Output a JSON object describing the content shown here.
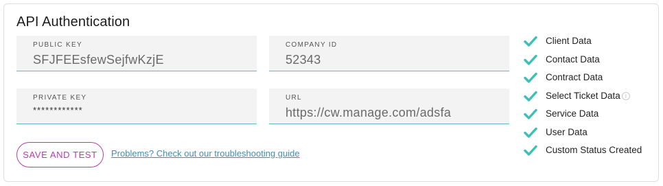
{
  "card": {
    "title": "API Authentication"
  },
  "fields": {
    "public_key": {
      "label": "PUBLIC KEY",
      "value": "SFJFEEsfewSejfwKzjE"
    },
    "company_id": {
      "label": "COMPANY ID",
      "value": "52343"
    },
    "private_key": {
      "label": "PRIVATE KEY",
      "value": "************"
    },
    "url": {
      "label": "URL",
      "value": "https://cw.manage.com/adsfa"
    }
  },
  "actions": {
    "save_label": "SAVE AND TEST",
    "help_link": "Problems?  Check out our troubleshooting guide"
  },
  "checklist": [
    {
      "label": "Client Data",
      "icon": "check-icon"
    },
    {
      "label": "Contact Data",
      "icon": "check-icon"
    },
    {
      "label": "Contract Data",
      "icon": "check-icon"
    },
    {
      "label": "Select Ticket Data",
      "icon": "check-icon",
      "info": "i"
    },
    {
      "label": "Service Data",
      "icon": "check-icon"
    },
    {
      "label": "User Data",
      "icon": "check-icon"
    },
    {
      "label": "Custom Status Created",
      "icon": "check-icon"
    }
  ],
  "colors": {
    "accent_check": "#3cbfb8",
    "field_underline": "#6ab5c2",
    "button_accent": "#b73bb0",
    "link": "#3d8fb8"
  }
}
